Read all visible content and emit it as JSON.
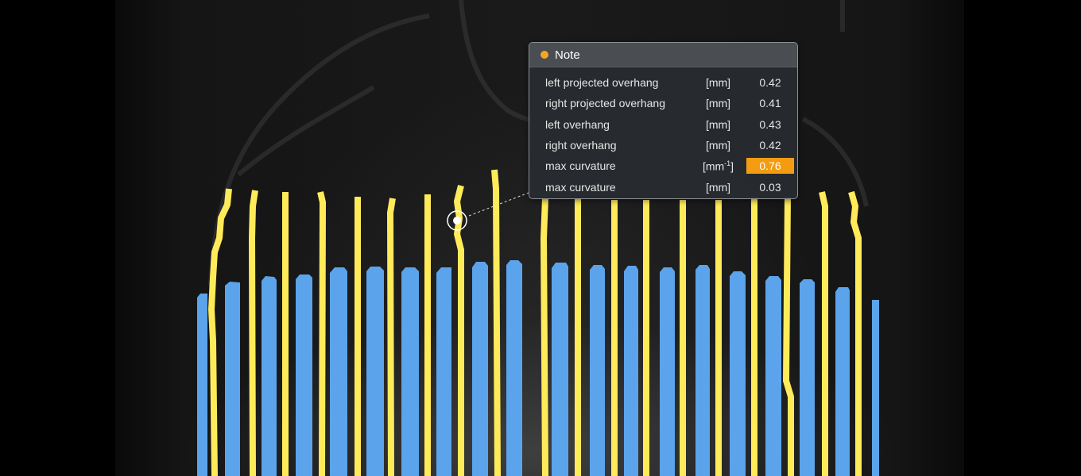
{
  "note": {
    "title": "Note",
    "accent_color": "#f5a623",
    "highlight_color": "#f39c12",
    "rows": [
      {
        "label": "left projected overhang",
        "unit": "[mm]",
        "value": "0.42",
        "highlighted": false
      },
      {
        "label": "right projected overhang",
        "unit": "[mm]",
        "value": "0.41",
        "highlighted": false
      },
      {
        "label": "left overhang",
        "unit": "[mm]",
        "value": "0.43",
        "highlighted": false
      },
      {
        "label": "right overhang",
        "unit": "[mm]",
        "value": "0.42",
        "highlighted": false
      },
      {
        "label": "max curvature",
        "unit": "[mm",
        "unit_sup": "-1",
        "unit_close": "]",
        "value": "0.76",
        "highlighted": true
      },
      {
        "label": "max curvature",
        "unit": "[mm]",
        "value": "0.03",
        "highlighted": false
      }
    ]
  },
  "colors": {
    "blue_segments": "#5ba3eb",
    "yellow_boundaries": "#ffeb5a",
    "marker": "#ffffff"
  }
}
